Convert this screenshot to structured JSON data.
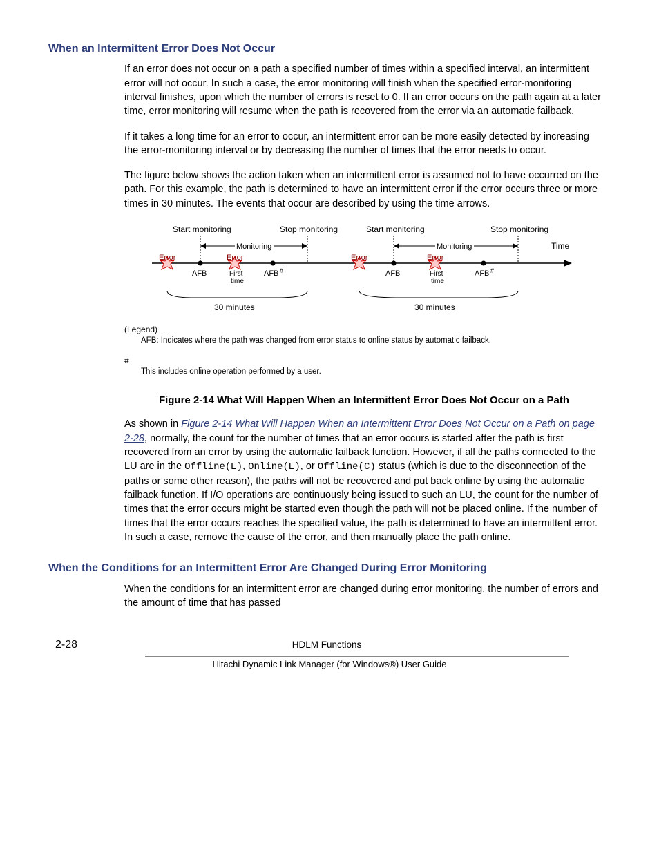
{
  "heading1": "When an Intermittent Error Does Not Occur",
  "para1": "If an error does not occur on a path a specified number of times within a specified interval, an intermittent error will not occur. In such a case, the error monitoring will finish when the specified error-monitoring interval finishes, upon which the number of errors is reset to 0. If an error occurs on the path again at a later time, error monitoring will resume when the path is recovered from the error via an automatic failback.",
  "para2": "If it takes a long time for an error to occur, an intermittent error can be more easily detected by increasing the error-monitoring interval or by decreasing the number of times that the error needs to occur.",
  "para3": "The figure below shows the action taken when an intermittent error is assumed not to have occurred on the path. For this example, the path is determined to have an intermittent error if the error occurs three or more times in 30 minutes. The events that occur are described by using the time arrows.",
  "fig": {
    "start_monitoring": "Start monitoring",
    "stop_monitoring": "Stop monitoring",
    "monitoring": "Monitoring",
    "time": "Time",
    "error": "Error",
    "afb": "AFB",
    "afb_hash": "AFB",
    "first_time": "First\ntime",
    "thirty_min": "30 minutes",
    "legend": "(Legend)",
    "afb_desc": "AFB: Indicates where the path was changed from error status to online status by automatic failback.",
    "hash": "#",
    "hash_desc": "This includes online operation performed by a user."
  },
  "figure_caption": "Figure 2-14 What Will Happen When an Intermittent Error Does Not Occur on a Path",
  "para4_pre": "As shown in ",
  "para4_link": "Figure 2-14 What Will Happen When an Intermittent Error Does Not Occur on a Path on page 2-28",
  "para4_mid1": ", normally, the count for the number of times that an error occurs is started after the path is first recovered from an error by using the automatic failback function. However, if all the paths connected to the LU are in the ",
  "para4_code1": "Offline(E)",
  "para4_comma1": ", ",
  "para4_code2": "Online(E)",
  "para4_comma2": ", or ",
  "para4_code3": "Offline(C)",
  "para4_mid2": " status (which is due to the disconnection of the paths or some other reason), the paths will not be recovered and put back online by using the automatic failback function. If I/O operations are continuously being issued to such an LU, the count for the number of times that the error occurs might be started even though the path will not be placed online. If the number of times that the error occurs reaches the specified value, the path is determined to have an intermittent error. In such a case, remove the cause of the error, and then manually place the path online.",
  "heading2": "When the Conditions for an Intermittent Error Are Changed During Error Monitoring",
  "para5": "When the conditions for an intermittent error are changed during error monitoring, the number of errors and the amount of time that has passed",
  "footer": {
    "pageno": "2-28",
    "title_top": "HDLM Functions",
    "title_bottom": "Hitachi Dynamic Link Manager (for Windows®) User Guide"
  }
}
